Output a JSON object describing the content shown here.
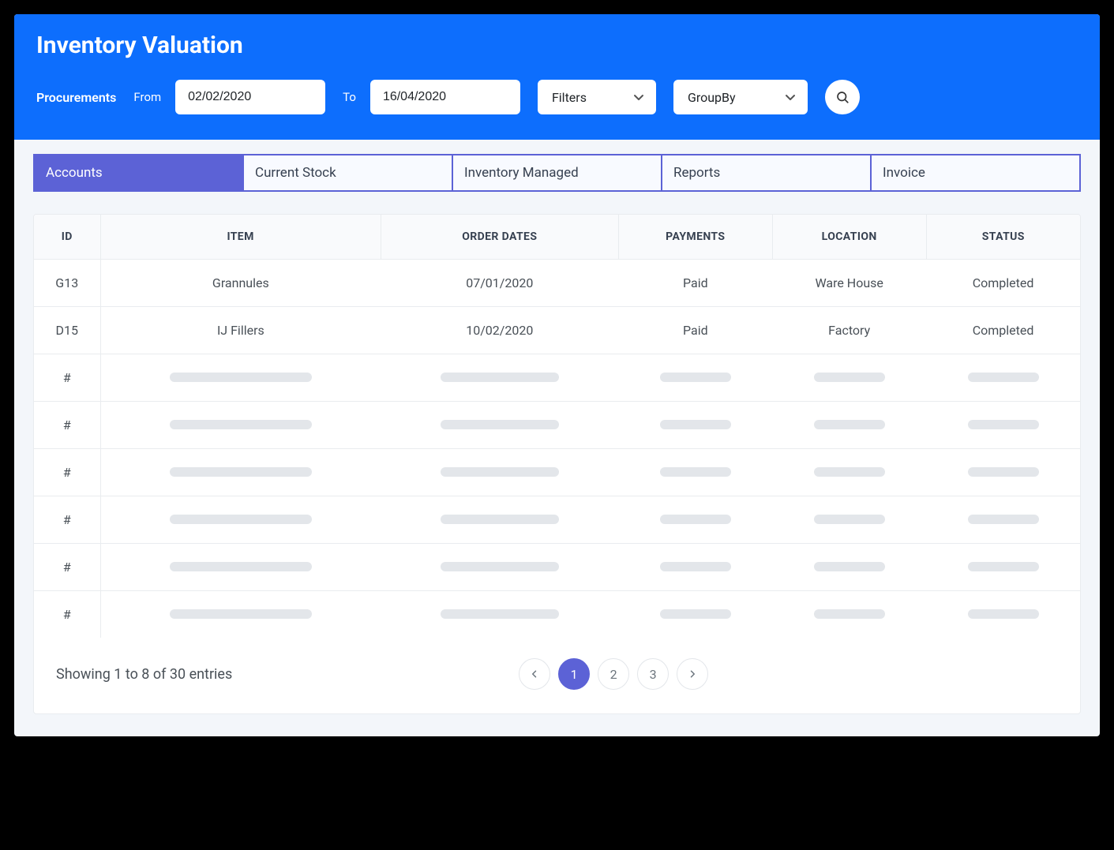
{
  "header": {
    "title": "Inventory Valuation",
    "section_label": "Procurements",
    "from_label": "From",
    "to_label": "To",
    "from_value": "02/02/2020",
    "to_value": "16/04/2020",
    "filters_label": "Filters",
    "groupby_label": "GroupBy"
  },
  "tabs": [
    {
      "label": "Accounts",
      "active": true
    },
    {
      "label": "Current Stock",
      "active": false
    },
    {
      "label": "Inventory Managed",
      "active": false
    },
    {
      "label": "Reports",
      "active": false
    },
    {
      "label": "Invoice",
      "active": false
    }
  ],
  "table": {
    "columns": [
      "ID",
      "ITEM",
      "ORDER DATES",
      "PAYMENTS",
      "LOCATION",
      "STATUS"
    ],
    "rows": [
      {
        "id": "G13",
        "item": "Grannules",
        "order_date": "07/01/2020",
        "payment": "Paid",
        "location": "Ware House",
        "status": "Completed"
      },
      {
        "id": "D15",
        "item": "IJ Fillers",
        "order_date": "10/02/2020",
        "payment": "Paid",
        "location": "Factory",
        "status": "Completed"
      }
    ],
    "placeholder_rows": 6,
    "placeholder_id": "#"
  },
  "footer": {
    "summary": "Showing 1 to 8 of 30 entries",
    "pages": [
      "1",
      "2",
      "3"
    ],
    "active_page": "1"
  }
}
